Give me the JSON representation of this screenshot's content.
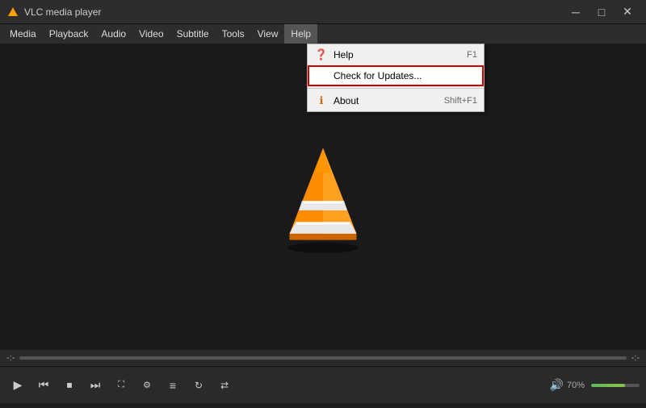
{
  "titleBar": {
    "icon": "🔶",
    "title": "VLC media player",
    "minimizeLabel": "─",
    "maximizeLabel": "□",
    "closeLabel": "✕"
  },
  "menuBar": {
    "items": [
      {
        "label": "Media",
        "id": "media"
      },
      {
        "label": "Playback",
        "id": "playback"
      },
      {
        "label": "Audio",
        "id": "audio"
      },
      {
        "label": "Video",
        "id": "video"
      },
      {
        "label": "Subtitle",
        "id": "subtitle"
      },
      {
        "label": "Tools",
        "id": "tools"
      },
      {
        "label": "View",
        "id": "view"
      },
      {
        "label": "Help",
        "id": "help",
        "active": true
      }
    ]
  },
  "helpMenu": {
    "items": [
      {
        "id": "help",
        "icon": "❓",
        "iconColor": "#cc6600",
        "label": "Help",
        "shortcut": "F1"
      },
      {
        "id": "check-updates",
        "icon": "",
        "label": "Check for Updates...",
        "shortcut": "",
        "highlighted": true
      },
      {
        "id": "separator"
      },
      {
        "id": "about",
        "icon": "ℹ️",
        "iconColor": "#cc6600",
        "label": "About",
        "shortcut": "Shift+F1"
      }
    ]
  },
  "seekBar": {
    "currentTime": "-:-",
    "totalTime": "-:-"
  },
  "controls": {
    "play": "▶",
    "skipBack": "⏮",
    "stop": "⏹",
    "skipForward": "⏭",
    "fullscreen": "⛶",
    "extended": "⚙",
    "playlist": "≡",
    "loop": "↻",
    "random": "⇄"
  },
  "volume": {
    "label": "70%",
    "level": 70
  }
}
